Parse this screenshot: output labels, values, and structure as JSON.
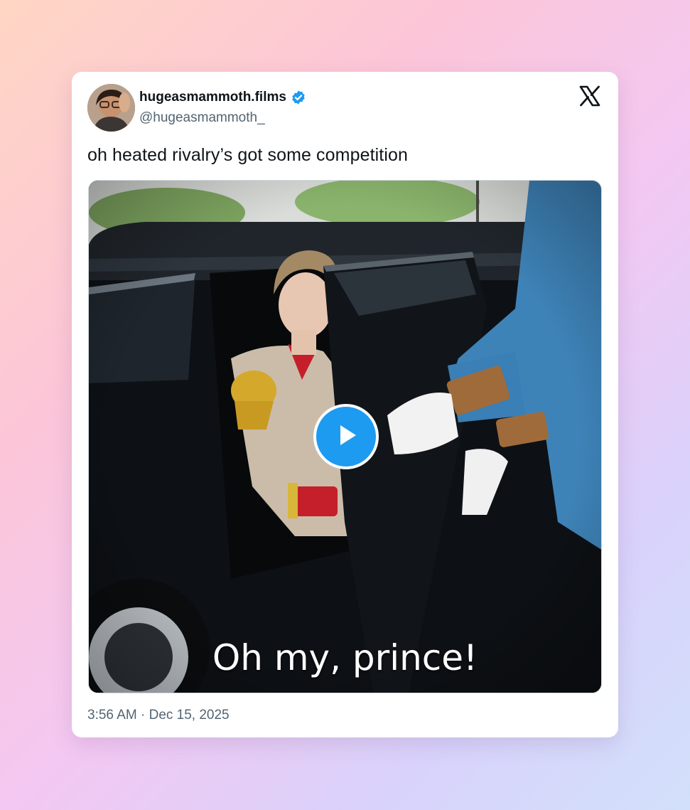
{
  "post": {
    "display_name": "hugeasmammoth.films",
    "handle": "@hugeasmammoth_",
    "verified_icon": "verified-badge-icon",
    "text": "oh heated rivalry’s got some competition",
    "video_caption": "Oh my, prince!",
    "timestamp": "3:56 AM · Dec 15, 2025"
  },
  "colors": {
    "verified": "#1d9bf0",
    "play": "#1d9bf0",
    "text_primary": "#0f1419",
    "text_secondary": "#536471"
  },
  "icons": {
    "logo": "x-logo-icon",
    "play": "play-icon",
    "avatar": "avatar"
  }
}
